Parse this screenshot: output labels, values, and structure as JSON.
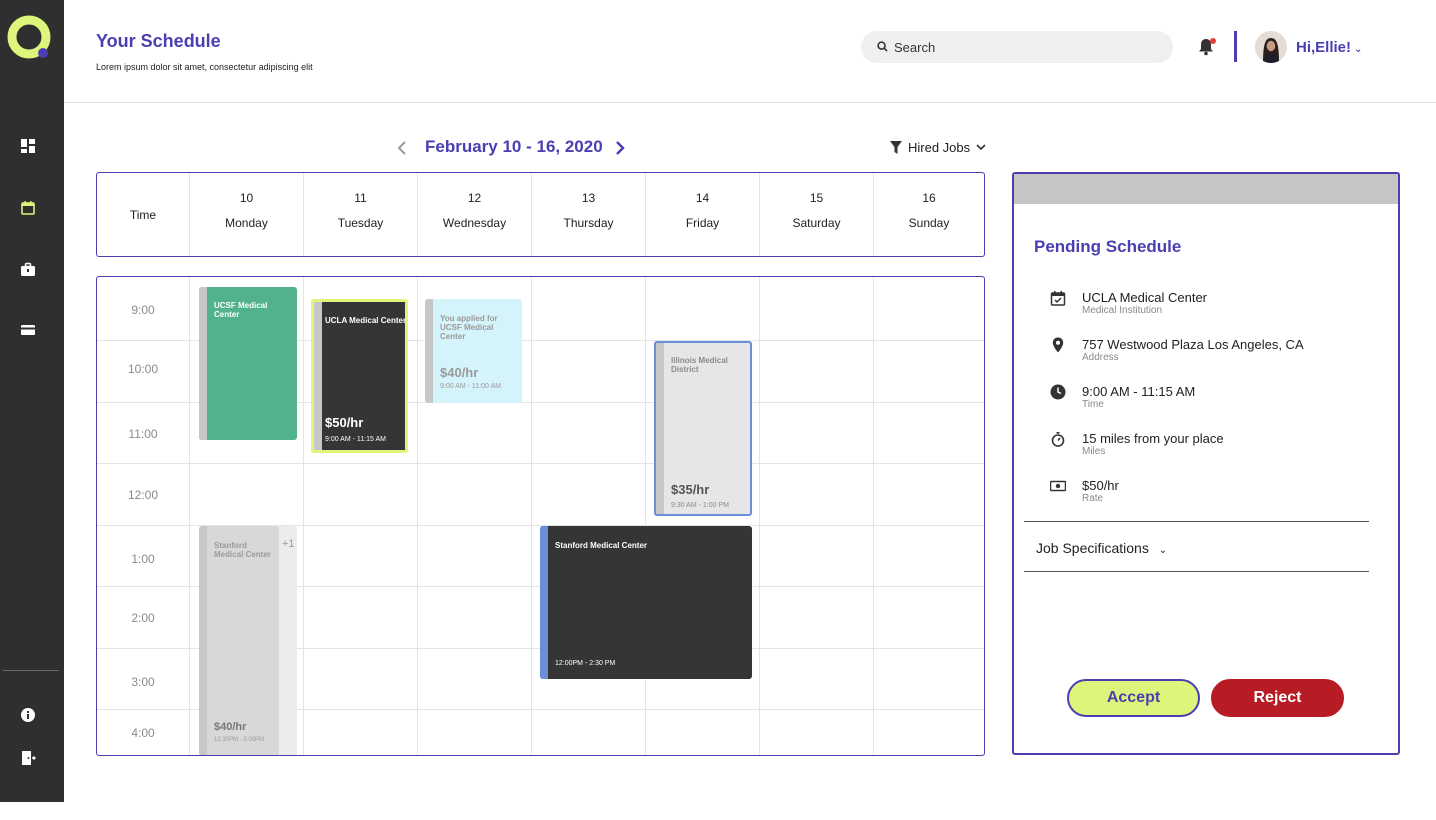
{
  "header": {
    "title": "Your Schedule",
    "subtitle": "Lorem ipsum dolor sit amet, consectetur adipiscing elit",
    "search_placeholder": "Search",
    "greeting": "Hi,Ellie!"
  },
  "sidebar": {
    "items": [
      {
        "icon": "dashboard-icon"
      },
      {
        "icon": "calendar-icon",
        "active": true
      },
      {
        "icon": "briefcase-icon"
      },
      {
        "icon": "credit-card-icon"
      },
      {
        "icon": "info-icon"
      },
      {
        "icon": "logout-icon"
      }
    ]
  },
  "calendar": {
    "week_label": "February 10 - 16, 2020",
    "filter_label": "Hired Jobs",
    "time_header": "Time",
    "days": [
      {
        "num": "10",
        "name": "Monday"
      },
      {
        "num": "11",
        "name": "Tuesday"
      },
      {
        "num": "12",
        "name": "Wednesday"
      },
      {
        "num": "13",
        "name": "Thursday"
      },
      {
        "num": "14",
        "name": "Friday"
      },
      {
        "num": "15",
        "name": "Saturday"
      },
      {
        "num": "16",
        "name": "Sunday"
      }
    ],
    "times": [
      "9:00",
      "10:00",
      "11:00",
      "12:00",
      "1:00",
      "2:00",
      "3:00",
      "4:00"
    ],
    "events": {
      "ucsf": {
        "title": "UCSF Medical Center"
      },
      "ucla": {
        "title": "UCLA Medical Center",
        "rate": "$50/hr",
        "time": "9:00 AM - 11:15 AM"
      },
      "applied": {
        "title": "You applied for UCSF Medical Center",
        "rate": "$40/hr",
        "time": "9:00 AM - 11:00 AM"
      },
      "illinois": {
        "title": "Illinois Medical District",
        "rate": "$35/hr",
        "time": "9:30 AM - 1:00 PM"
      },
      "stanford_mon": {
        "title": "Stanford Medical Center",
        "rate": "$40/hr",
        "time": "12:30PM - 5:00PM",
        "more": "+1"
      },
      "stanford_thu": {
        "title": "Stanford Medical Center",
        "time": "12:00PM - 2:30 PM"
      }
    }
  },
  "pending": {
    "title": "Pending Schedule",
    "rows": [
      {
        "value": "UCLA Medical Center",
        "label": "Medical Institution",
        "icon": "calendar-check-icon"
      },
      {
        "value": "757 Westwood Plaza Los Angeles, CA",
        "label": "Address",
        "icon": "location-pin-icon"
      },
      {
        "value": "9:00 AM - 11:15 AM",
        "label": "Time",
        "icon": "clock-icon"
      },
      {
        "value": "15 miles from your place",
        "label": "Miles",
        "icon": "stopwatch-icon"
      },
      {
        "value": "$50/hr",
        "label": "Rate",
        "icon": "cash-icon"
      }
    ],
    "specs_label": "Job Specifications",
    "accept_label": "Accept",
    "reject_label": "Reject"
  },
  "colors": {
    "brand": "#4a3fb0",
    "accent": "#dcf57a",
    "sidebar": "#2f2f2f",
    "reject": "#b71c24",
    "event_green": "#52b28d",
    "event_dark": "#353535",
    "event_light_blue": "#d5f3fb"
  }
}
